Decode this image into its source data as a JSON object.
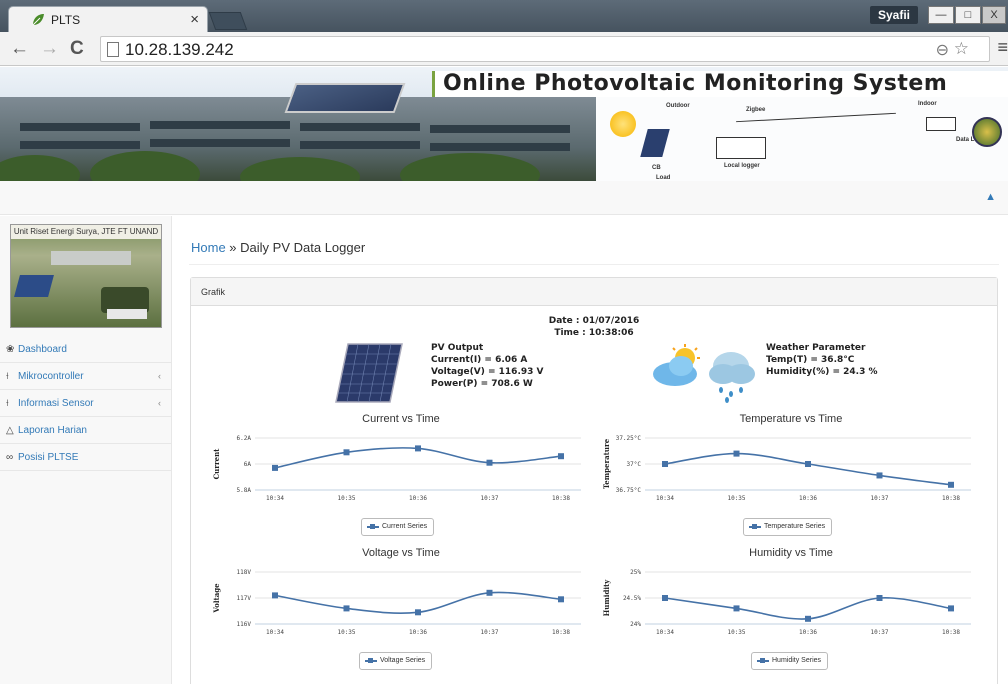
{
  "browser": {
    "tab_title": "PLTS",
    "tab_close": "×",
    "user": "Syafii",
    "win_min": "—",
    "win_max": "□",
    "win_close": "X",
    "url": "10.28.139.242",
    "icons": [
      "back-arrow-icon",
      "forward-arrow-icon",
      "reload-icon",
      "page-icon",
      "zoom-icon",
      "star-icon",
      "menu-icon"
    ]
  },
  "banner": {
    "title": "Online Photovoltaic Monitoring System",
    "diagram_outdoor": "Outdoor",
    "diagram_indoor": "Indoor",
    "diagram_local_logger": "Local logger",
    "diagram_data_logger": "Data Logger",
    "diagram_zigbee": "Zigbee",
    "diagram_cb": "CB",
    "diagram_load": "Load"
  },
  "sidebar": {
    "photo_caption": "Unit Riset Energi Surya, JTE FT UNAND",
    "items": [
      {
        "label": "Dashboard",
        "icon": "dashboard-icon",
        "caret": ""
      },
      {
        "label": "Mikrocontroller",
        "icon": "wrench-icon",
        "caret": "‹"
      },
      {
        "label": "Informasi Sensor",
        "icon": "wrench-icon",
        "caret": "‹"
      },
      {
        "label": "Laporan Harian",
        "icon": "sitemap-icon",
        "caret": ""
      },
      {
        "label": "Posisi PLTSE",
        "icon": "chain-icon",
        "caret": ""
      }
    ]
  },
  "breadcrumb": {
    "home": "Home",
    "sep": " » ",
    "current": "Daily PV Data Logger"
  },
  "panel": {
    "header": "Grafik",
    "date": "Date : 01/07/2016",
    "time": "Time : 10:38:06",
    "pv_title": "PV Output",
    "pv_current": "Current(I) = 6.06 A",
    "pv_voltage": "Voltage(V) = 116.93 V",
    "pv_power": "Power(P) = 708.6 W",
    "wx_title": "Weather Parameter",
    "wx_temp": "Temp(T) = 36.8°C",
    "wx_humidity": "Humidity(%) = 24.3 %"
  },
  "chart_data": [
    {
      "type": "line",
      "title": "Current vs Time",
      "ylabel": "Current",
      "categories": [
        "10:34",
        "10:35",
        "10:36",
        "10:37",
        "10:38"
      ],
      "yticks": [
        "5.8A",
        "6A",
        "6.2A"
      ],
      "ylim": [
        5.8,
        6.2
      ],
      "series": [
        {
          "name": "Current Series",
          "values": [
            5.97,
            6.09,
            6.12,
            6.01,
            6.06
          ]
        }
      ],
      "color": "#4572a7"
    },
    {
      "type": "line",
      "title": "Temperature vs Time",
      "ylabel": "Temperature",
      "categories": [
        "10:34",
        "10:35",
        "10:36",
        "10:37",
        "10:38"
      ],
      "yticks": [
        "36.75°C",
        "37°C",
        "37.25°C"
      ],
      "ylim": [
        36.75,
        37.25
      ],
      "series": [
        {
          "name": "Temperature Series",
          "values": [
            37.0,
            37.1,
            37.0,
            36.89,
            36.8
          ]
        }
      ],
      "color": "#4572a7"
    },
    {
      "type": "line",
      "title": "Voltage vs Time",
      "ylabel": "Voltage",
      "categories": [
        "10:34",
        "10:35",
        "10:36",
        "10:37",
        "10:38"
      ],
      "yticks": [
        "116V",
        "117V",
        "118V"
      ],
      "ylim": [
        116,
        118
      ],
      "series": [
        {
          "name": "Voltage Series",
          "values": [
            117.1,
            116.6,
            116.45,
            117.2,
            116.95
          ]
        }
      ],
      "color": "#4572a7"
    },
    {
      "type": "line",
      "title": "Humidity vs Time",
      "ylabel": "Humidity",
      "categories": [
        "10:34",
        "10:35",
        "10:36",
        "10:37",
        "10:38"
      ],
      "yticks": [
        "24%",
        "24.5%",
        "25%"
      ],
      "ylim": [
        24,
        25
      ],
      "series": [
        {
          "name": "Humidity Series",
          "values": [
            24.5,
            24.3,
            24.1,
            24.5,
            24.3
          ]
        }
      ],
      "color": "#4572a7"
    }
  ]
}
